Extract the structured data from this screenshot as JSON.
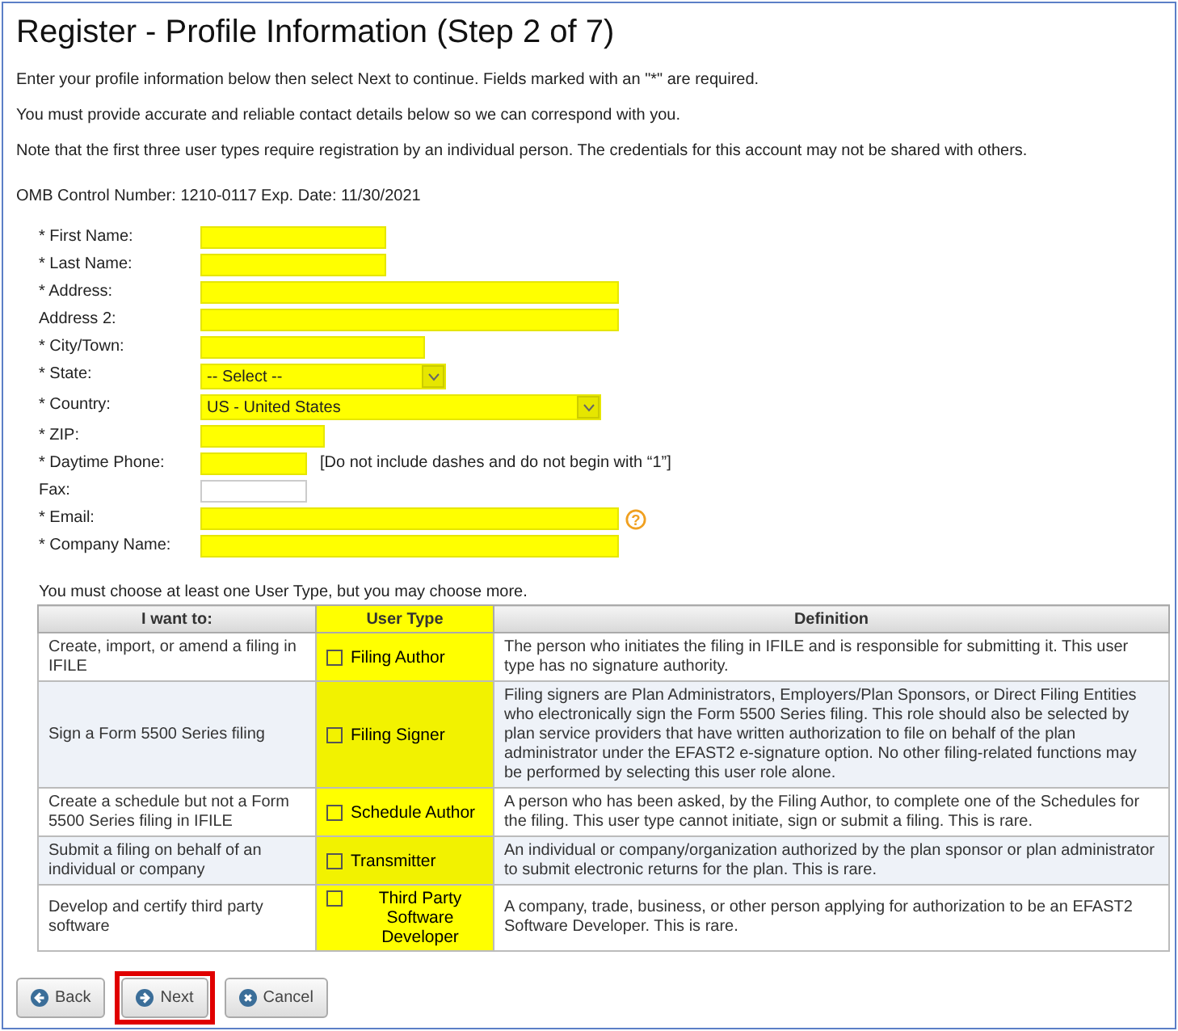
{
  "title": "Register - Profile Information (Step 2 of 7)",
  "intro": [
    "Enter your profile information below then select Next to continue. Fields marked with an \"*\" are required.",
    "You must provide accurate and reliable contact details below so we can correspond with you.",
    "Note that the first three user types require registration by an individual person. The credentials for this account may not be shared with others.",
    "OMB Control Number: 1210-0117 Exp. Date: 11/30/2021"
  ],
  "fields": [
    {
      "label": "* First Name:",
      "kind": "text",
      "highlighted": true
    },
    {
      "label": "* Last Name:",
      "kind": "text",
      "highlighted": true
    },
    {
      "label": "* Address:",
      "kind": "text",
      "highlighted": true
    },
    {
      "label": "Address 2:",
      "kind": "text",
      "highlighted": true
    },
    {
      "label": "* City/Town:",
      "kind": "text",
      "highlighted": true
    },
    {
      "label": "* State:",
      "kind": "select",
      "value": "-- Select --",
      "highlighted": true
    },
    {
      "label": "* Country:",
      "kind": "select",
      "value": "US - United States",
      "highlighted": true
    },
    {
      "label": "* ZIP:",
      "kind": "text",
      "highlighted": true
    },
    {
      "label": "* Daytime Phone:",
      "kind": "text",
      "highlighted": true,
      "note": "[Do not include dashes and do not begin with “1”]"
    },
    {
      "label": "Fax:",
      "kind": "text",
      "highlighted": false
    },
    {
      "label": "* Email:",
      "kind": "text",
      "highlighted": true,
      "help": "?"
    },
    {
      "label": "* Company Name:",
      "kind": "text",
      "highlighted": true
    }
  ],
  "user_type_prompt": "You must choose at least one User Type, but you may choose more.",
  "table": {
    "columns": [
      "I want to:",
      "User Type",
      "Definition"
    ],
    "rows": [
      {
        "want": "Create, import, or amend a filing in IFILE",
        "type": "Filing Author",
        "checked": false,
        "definition": "The person who initiates the filing in IFILE and is responsible for submitting it. This user type has no signature authority."
      },
      {
        "want": "Sign a Form 5500 Series filing",
        "type": "Filing Signer",
        "checked": false,
        "definition": "Filing signers are Plan Administrators, Employers/Plan Sponsors, or Direct Filing Entities who electronically sign the Form 5500 Series filing. This role should also be selected by plan service providers that have written authorization to file on behalf of the plan administrator under the EFAST2 e-signature option. No other filing-related functions may be performed by selecting this user role alone."
      },
      {
        "want": "Create a schedule but not a Form 5500 Series filing in IFILE",
        "type": "Schedule Author",
        "checked": false,
        "definition": "A person who has been asked, by the Filing Author, to complete one of the Schedules for the filing. This user type cannot initiate, sign or submit a filing. This is rare."
      },
      {
        "want": "Submit a filing on behalf of an individual or company",
        "type": "Transmitter",
        "checked": false,
        "definition": "An individual or company/organization authorized by the plan sponsor or plan administrator to submit electronic returns for the plan. This is rare."
      },
      {
        "want": "Develop and certify third party software",
        "type": "Third Party Software Developer",
        "checked": false,
        "definition": "A company, trade, business, or other person applying for authorization to be an EFAST2 Software Developer. This is rare."
      }
    ]
  },
  "buttons": [
    {
      "label": "Back",
      "kind": "back",
      "highlighted": false
    },
    {
      "label": "Next",
      "kind": "next",
      "highlighted": true
    },
    {
      "label": "Cancel",
      "kind": "cancel",
      "highlighted": false
    }
  ]
}
